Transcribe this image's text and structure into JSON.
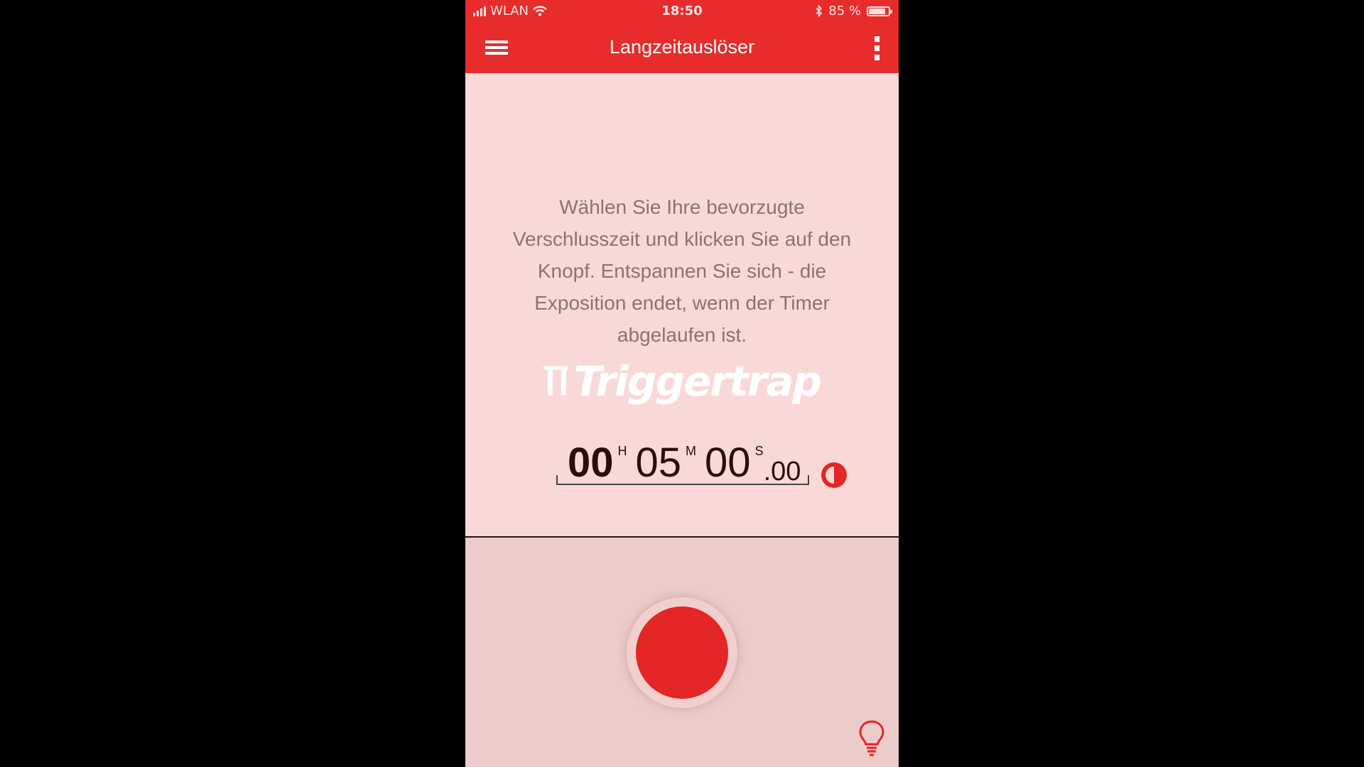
{
  "status_bar": {
    "carrier": "WLAN",
    "time": "18:50",
    "battery": "85 %",
    "battery_level": 0.85,
    "icons": [
      "signal-icon",
      "wifi-icon",
      "bluetooth-icon",
      "battery-icon"
    ]
  },
  "navbar": {
    "title": "Langzeitauslöser",
    "left_icon": "menu-icon",
    "right_icon": "more-vertical-icon"
  },
  "main": {
    "description": "Wählen Sie Ihre bevorzugte Verschlusszeit und klicken Sie auf den Knopf. Entspannen Sie sich - die Exposition endet, wenn der Timer abgelaufen ist.",
    "logo_text": "Triggertrap",
    "timer": {
      "hours": "00",
      "hours_unit": "H",
      "minutes": "05",
      "minutes_unit": "M",
      "seconds": "00",
      "seconds_unit": "S",
      "fraction": ".00"
    },
    "contrast_icon": "half-circle-icon"
  },
  "bottom": {
    "shutter_icon": "shutter-button",
    "tip_icon": "lightbulb-icon"
  },
  "colors": {
    "accent": "#e82c2c",
    "background": "#f9d9d8",
    "panel": "#ebcccb",
    "text": "#8a7373"
  }
}
